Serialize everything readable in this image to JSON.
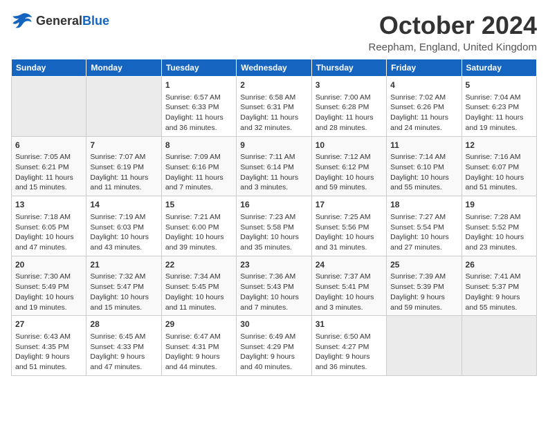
{
  "header": {
    "logo_general": "General",
    "logo_blue": "Blue",
    "month": "October 2024",
    "location": "Reepham, England, United Kingdom"
  },
  "days_of_week": [
    "Sunday",
    "Monday",
    "Tuesday",
    "Wednesday",
    "Thursday",
    "Friday",
    "Saturday"
  ],
  "weeks": [
    [
      {
        "day": "",
        "info": ""
      },
      {
        "day": "",
        "info": ""
      },
      {
        "day": "1",
        "info": "Sunrise: 6:57 AM\nSunset: 6:33 PM\nDaylight: 11 hours and 36 minutes."
      },
      {
        "day": "2",
        "info": "Sunrise: 6:58 AM\nSunset: 6:31 PM\nDaylight: 11 hours and 32 minutes."
      },
      {
        "day": "3",
        "info": "Sunrise: 7:00 AM\nSunset: 6:28 PM\nDaylight: 11 hours and 28 minutes."
      },
      {
        "day": "4",
        "info": "Sunrise: 7:02 AM\nSunset: 6:26 PM\nDaylight: 11 hours and 24 minutes."
      },
      {
        "day": "5",
        "info": "Sunrise: 7:04 AM\nSunset: 6:23 PM\nDaylight: 11 hours and 19 minutes."
      }
    ],
    [
      {
        "day": "6",
        "info": "Sunrise: 7:05 AM\nSunset: 6:21 PM\nDaylight: 11 hours and 15 minutes."
      },
      {
        "day": "7",
        "info": "Sunrise: 7:07 AM\nSunset: 6:19 PM\nDaylight: 11 hours and 11 minutes."
      },
      {
        "day": "8",
        "info": "Sunrise: 7:09 AM\nSunset: 6:16 PM\nDaylight: 11 hours and 7 minutes."
      },
      {
        "day": "9",
        "info": "Sunrise: 7:11 AM\nSunset: 6:14 PM\nDaylight: 11 hours and 3 minutes."
      },
      {
        "day": "10",
        "info": "Sunrise: 7:12 AM\nSunset: 6:12 PM\nDaylight: 10 hours and 59 minutes."
      },
      {
        "day": "11",
        "info": "Sunrise: 7:14 AM\nSunset: 6:10 PM\nDaylight: 10 hours and 55 minutes."
      },
      {
        "day": "12",
        "info": "Sunrise: 7:16 AM\nSunset: 6:07 PM\nDaylight: 10 hours and 51 minutes."
      }
    ],
    [
      {
        "day": "13",
        "info": "Sunrise: 7:18 AM\nSunset: 6:05 PM\nDaylight: 10 hours and 47 minutes."
      },
      {
        "day": "14",
        "info": "Sunrise: 7:19 AM\nSunset: 6:03 PM\nDaylight: 10 hours and 43 minutes."
      },
      {
        "day": "15",
        "info": "Sunrise: 7:21 AM\nSunset: 6:00 PM\nDaylight: 10 hours and 39 minutes."
      },
      {
        "day": "16",
        "info": "Sunrise: 7:23 AM\nSunset: 5:58 PM\nDaylight: 10 hours and 35 minutes."
      },
      {
        "day": "17",
        "info": "Sunrise: 7:25 AM\nSunset: 5:56 PM\nDaylight: 10 hours and 31 minutes."
      },
      {
        "day": "18",
        "info": "Sunrise: 7:27 AM\nSunset: 5:54 PM\nDaylight: 10 hours and 27 minutes."
      },
      {
        "day": "19",
        "info": "Sunrise: 7:28 AM\nSunset: 5:52 PM\nDaylight: 10 hours and 23 minutes."
      }
    ],
    [
      {
        "day": "20",
        "info": "Sunrise: 7:30 AM\nSunset: 5:49 PM\nDaylight: 10 hours and 19 minutes."
      },
      {
        "day": "21",
        "info": "Sunrise: 7:32 AM\nSunset: 5:47 PM\nDaylight: 10 hours and 15 minutes."
      },
      {
        "day": "22",
        "info": "Sunrise: 7:34 AM\nSunset: 5:45 PM\nDaylight: 10 hours and 11 minutes."
      },
      {
        "day": "23",
        "info": "Sunrise: 7:36 AM\nSunset: 5:43 PM\nDaylight: 10 hours and 7 minutes."
      },
      {
        "day": "24",
        "info": "Sunrise: 7:37 AM\nSunset: 5:41 PM\nDaylight: 10 hours and 3 minutes."
      },
      {
        "day": "25",
        "info": "Sunrise: 7:39 AM\nSunset: 5:39 PM\nDaylight: 9 hours and 59 minutes."
      },
      {
        "day": "26",
        "info": "Sunrise: 7:41 AM\nSunset: 5:37 PM\nDaylight: 9 hours and 55 minutes."
      }
    ],
    [
      {
        "day": "27",
        "info": "Sunrise: 6:43 AM\nSunset: 4:35 PM\nDaylight: 9 hours and 51 minutes."
      },
      {
        "day": "28",
        "info": "Sunrise: 6:45 AM\nSunset: 4:33 PM\nDaylight: 9 hours and 47 minutes."
      },
      {
        "day": "29",
        "info": "Sunrise: 6:47 AM\nSunset: 4:31 PM\nDaylight: 9 hours and 44 minutes."
      },
      {
        "day": "30",
        "info": "Sunrise: 6:49 AM\nSunset: 4:29 PM\nDaylight: 9 hours and 40 minutes."
      },
      {
        "day": "31",
        "info": "Sunrise: 6:50 AM\nSunset: 4:27 PM\nDaylight: 9 hours and 36 minutes."
      },
      {
        "day": "",
        "info": ""
      },
      {
        "day": "",
        "info": ""
      }
    ]
  ]
}
